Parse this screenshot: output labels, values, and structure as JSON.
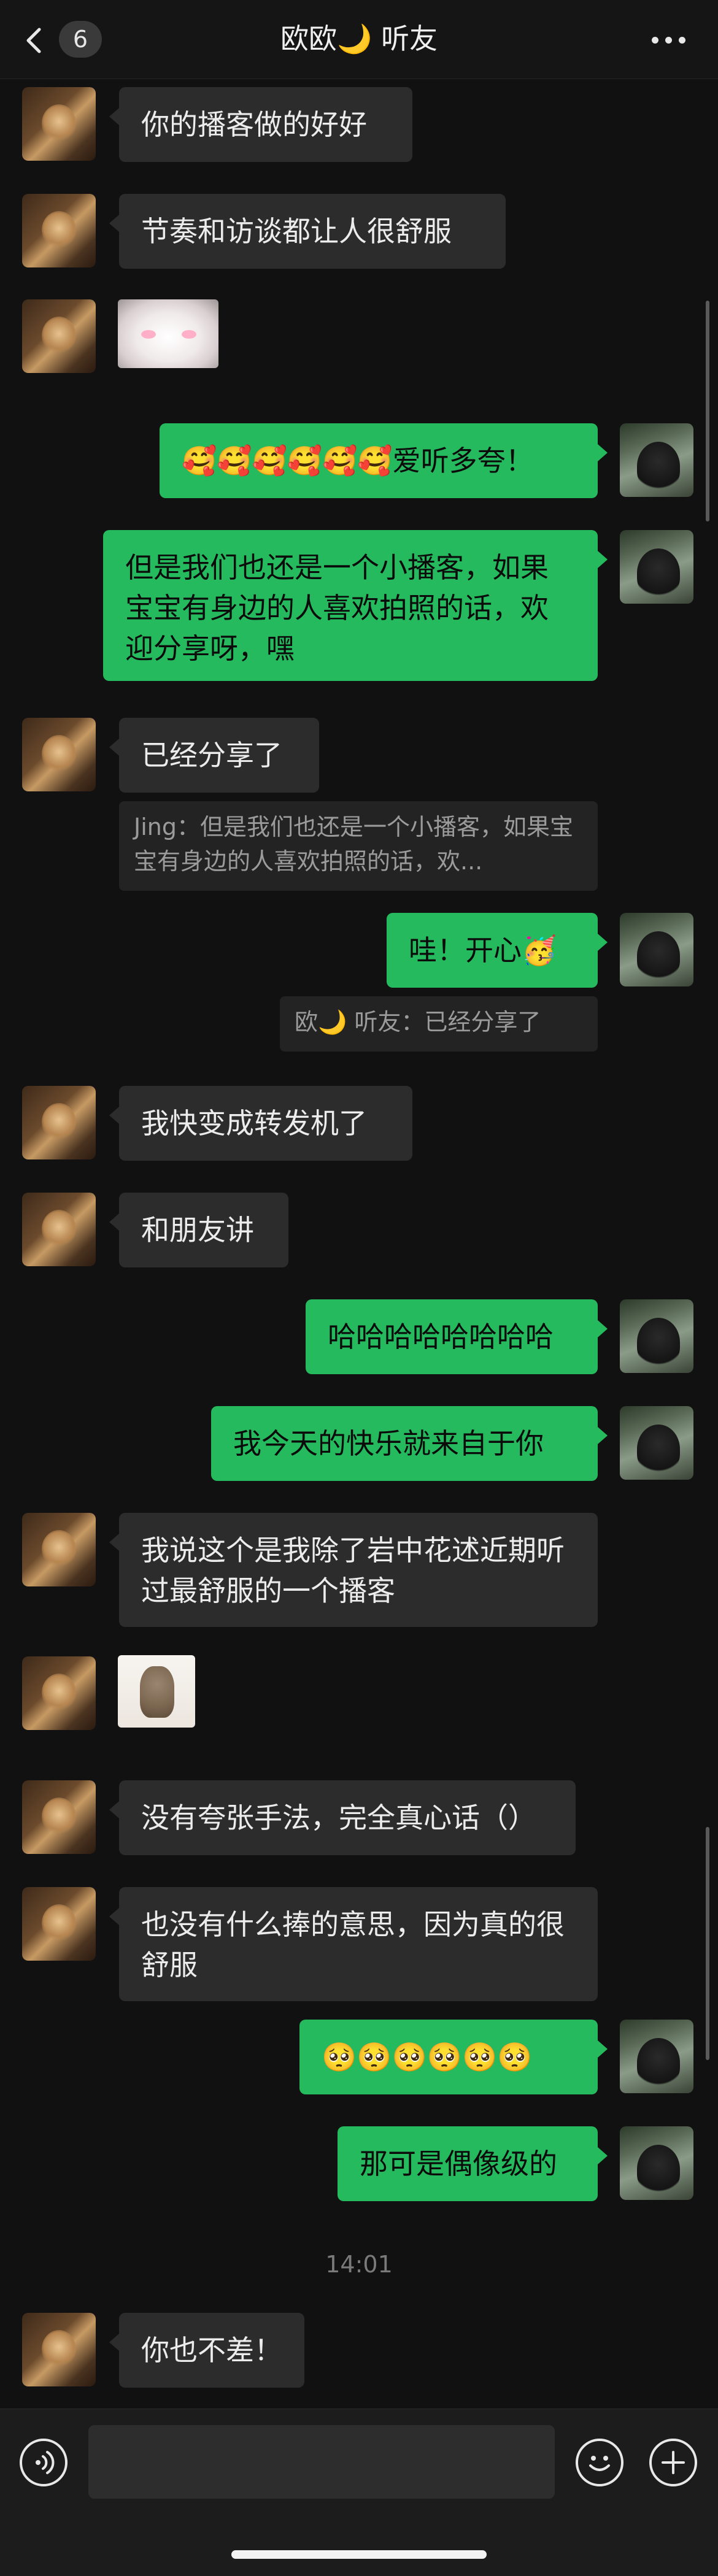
{
  "header": {
    "unread_count": "6",
    "title": "欧欧🌙 听友",
    "icons": [
      "chevron-left-icon",
      "more-icon"
    ]
  },
  "messages": [
    {
      "side": "in",
      "type": "text",
      "text": "你的播客做的好好"
    },
    {
      "side": "in",
      "type": "text",
      "text": "节奏和访谈都让人很舒服"
    },
    {
      "side": "in",
      "type": "sticker",
      "sticker": "white-kitten-blushing"
    },
    {
      "side": "out",
      "type": "text",
      "text": "🥰🥰🥰🥰🥰🥰爱听多夸！"
    },
    {
      "side": "out",
      "type": "text",
      "text": "但是我们也还是一个小播客，如果宝宝有身边的人喜欢拍照的话，欢迎分享呀，嘿"
    },
    {
      "side": "in",
      "type": "text",
      "text": "已经分享了",
      "quote": "Jing：但是我们也还是一个小播客，如果宝宝有身边的人喜欢拍照的话，欢..."
    },
    {
      "side": "out",
      "type": "text",
      "text": "哇！开心🥳",
      "quote": "欧🌙 听友：已经分享了"
    },
    {
      "side": "in",
      "type": "text",
      "text": "我快变成转发机了"
    },
    {
      "side": "in",
      "type": "text",
      "text": "和朋友讲"
    },
    {
      "side": "out",
      "type": "text",
      "text": "哈哈哈哈哈哈哈哈"
    },
    {
      "side": "out",
      "type": "text",
      "text": "我今天的快乐就来自于你"
    },
    {
      "side": "in",
      "type": "text",
      "text": "我说这个是我除了岩中花述近期听过最舒服的一个播客"
    },
    {
      "side": "in",
      "type": "sticker",
      "sticker": "otter"
    },
    {
      "side": "in",
      "type": "text",
      "text": "没有夸张手法，完全真心话（）"
    },
    {
      "side": "in",
      "type": "text",
      "text": "也没有什么捧的意思，因为真的很舒服"
    },
    {
      "side": "out",
      "type": "text",
      "text": "🥺🥺🥺🥺🥺🥺"
    },
    {
      "side": "out",
      "type": "text",
      "text": "那可是偶像级的"
    },
    {
      "side": "in",
      "type": "text",
      "text": "你也不差！"
    }
  ],
  "timestamp": "14:01",
  "input_bar": {
    "icons": [
      "voice-icon",
      "emoji-icon",
      "add-icon"
    ],
    "input_value": ""
  },
  "colors": {
    "background": "#111111",
    "bubble_in": "#2c2c2c",
    "bubble_out": "#26ba5e"
  }
}
